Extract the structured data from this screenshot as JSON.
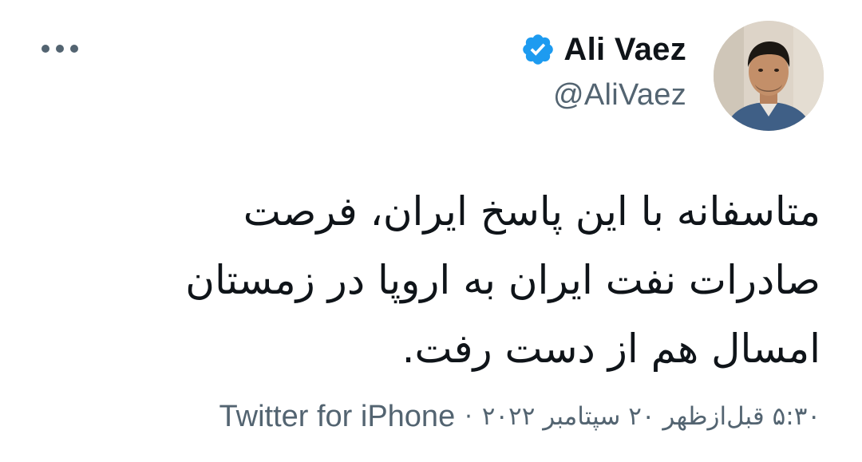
{
  "author": {
    "display_name": "Ali Vaez",
    "handle": "@AliVaez",
    "verified": true
  },
  "tweet": {
    "lines": [
      "متاسفانه با این پاسخ ایران، فرصت",
      "صادرات نفت ایران به اروپا در زمستان",
      "امسال هم از دست رفت."
    ]
  },
  "meta": {
    "timestamp": "۵:۳۰ قبل‌ازظهر ۲۰ سپتامبر ۲۰۲۲",
    "separator": "·",
    "source": "Twitter for iPhone"
  },
  "icons": {
    "more": "more-horizontal-icon",
    "verified": "verified-badge-icon"
  },
  "colors": {
    "verified_blue": "#1d9bf0",
    "secondary_text": "#536471",
    "primary_text": "#0f1419"
  }
}
